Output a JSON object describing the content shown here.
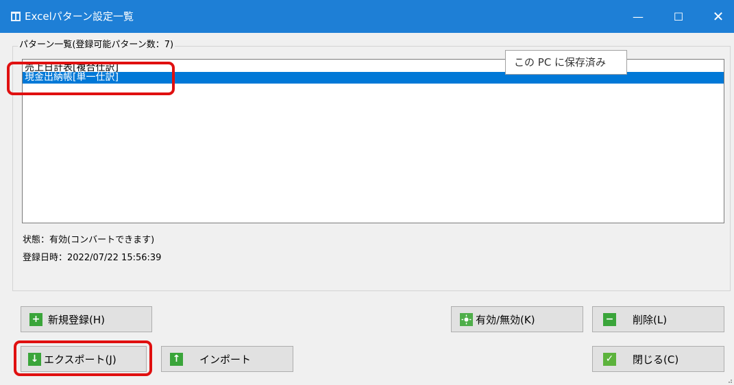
{
  "window": {
    "title": "Excelパターン設定一覧",
    "minimize_glyph": "—",
    "maximize_glyph": "☐",
    "close_glyph": "✕",
    "titlebar_color": "#1e7fd6"
  },
  "pattern_list": {
    "group_label": "パターン一覧(登録可能パターン数：7)",
    "items": [
      {
        "label": "売上日計表[複合仕訳]",
        "selected": false
      },
      {
        "label": "現金出納帳[単一仕訳]",
        "selected": true
      }
    ],
    "selection_color": "#0078d7"
  },
  "tooltip": {
    "text": "この PC に保存済み"
  },
  "details": {
    "status": "状態：有効(コンバートできます)",
    "registered_at": "登録日時：2022/07/22 15:56:39"
  },
  "buttons": {
    "new": {
      "label": "新規登録(H)",
      "icon": "plus-icon"
    },
    "toggle": {
      "label": "有効/無効(K)",
      "icon": "toggle-status-icon"
    },
    "delete": {
      "label": "削除(L)",
      "icon": "minus-icon"
    },
    "export": {
      "label": "エクスポート(J)",
      "icon": "arrow-down-icon"
    },
    "import": {
      "label": "インポート",
      "icon": "arrow-up-icon"
    },
    "close": {
      "label": "閉じる(C)",
      "icon": "check-icon"
    }
  },
  "annotation_color": "#e01010"
}
